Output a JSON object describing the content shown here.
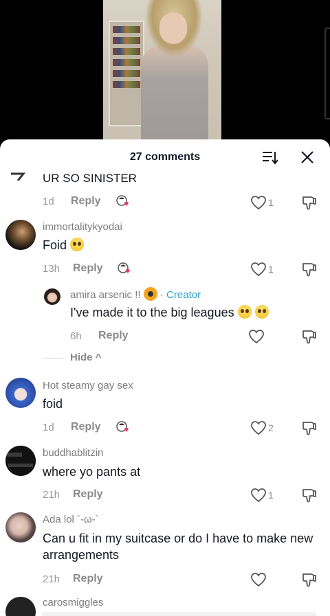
{
  "header": {
    "title": "27 comments"
  },
  "comments": [
    {
      "username": "",
      "text": "UR SO SINISTER",
      "time": "1d",
      "reply": "Reply",
      "likes": "1"
    },
    {
      "username": "immortalitykyodai",
      "text": "Foid",
      "time": "13h",
      "reply": "Reply",
      "likes": "1"
    },
    {
      "username": "amira arsenic !!",
      "creator_label": "· Creator",
      "text": "I've made it to the big leagues",
      "time": "6h",
      "reply": "Reply",
      "likes": ""
    },
    {
      "username": "Hot steamy gay sex",
      "text": "foid",
      "time": "1d",
      "reply": "Reply",
      "likes": "2"
    },
    {
      "username": "buddhablitzin",
      "text": "where yo pants at",
      "time": "21h",
      "reply": "Reply",
      "likes": "1"
    },
    {
      "username": "Ada lol `-ω-`",
      "text": "Can u fit in my suitcase or do I have to make new arrangements",
      "time": "21h",
      "reply": "Reply",
      "likes": ""
    },
    {
      "username": "carosmiggles"
    }
  ],
  "hide_label": "Hide ^",
  "colors": {
    "creator": "#2fa3c7",
    "text": "#161823",
    "muted": "#8a8a8a"
  },
  "icons": [
    "sort-icon",
    "close-icon",
    "heart-icon",
    "dislike-icon",
    "creator-liked-icon"
  ]
}
